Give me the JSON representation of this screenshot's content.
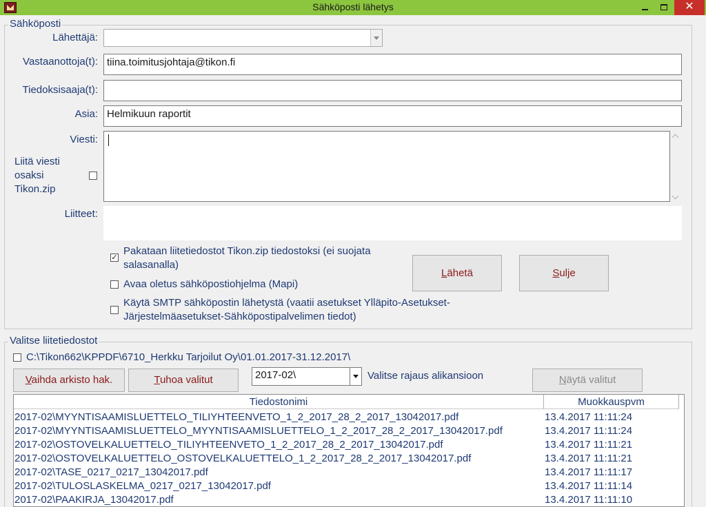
{
  "window": {
    "title": "Sähköposti lähetys"
  },
  "email": {
    "group_label": "Sähköposti",
    "sender_label": "Lähettäjä:",
    "sender_value": "",
    "recipients_label": "Vastaanottoja(t):",
    "recipients_value": "tiina.toimitusjohtaja@tikon.fi",
    "cc_label": "Tiedoksisaaja(t):",
    "cc_value": "",
    "subject_label": "Asia:",
    "subject_value": "Helmikuun raportit",
    "message_label": "Viesti:",
    "attach_message_label": "Liitä viesti osaksi Tikon.zip",
    "attach_message_checked": false,
    "attachments_label": "Liitteet:",
    "attachments_value": "",
    "options": [
      {
        "label": "Pakataan liitetiedostot Tikon.zip tiedostoksi  (ei suojata salasanalla)",
        "checked": true
      },
      {
        "label": "Avaa oletus sähköpostiohjelma (Mapi)",
        "checked": false
      },
      {
        "label": "Käytä SMTP sähköpostin lähetystä (vaatii asetukset Ylläpito-Asetukset-Järjestelmäasetukset-Sähköpostipalvelimen tiedot)",
        "checked": false
      }
    ],
    "send_button": {
      "underline": "L",
      "rest": "ähetä"
    },
    "close_button": {
      "underline": "S",
      "rest": "ulje"
    }
  },
  "files": {
    "group_label": "Valitse liitetiedostot",
    "archive_path": "C:\\Tikon662\\KPPDF\\6710_Herkku Tarjoilut Oy\\01.01.2017-31.12.2017\\",
    "archive_checked": false,
    "change_archive_button": {
      "underline": "V",
      "rest": "aihda arkisto hak."
    },
    "delete_button": {
      "underline": "T",
      "rest": "uhoa valitut"
    },
    "subfolder_value": "2017-02\\",
    "subfolder_label": "Valitse rajaus alikansioon",
    "show_selected_button": {
      "underline": "N",
      "rest": "äytä valitut"
    },
    "columns": [
      "Tiedostonimi",
      "Muokkauspvm"
    ],
    "rows": [
      {
        "name": "2017-02\\MYYNTISAAMISLUETTELO_TILIYHTEENVETO_1_2_2017_28_2_2017_13042017.pdf",
        "date": "13.4.2017 11:11:24"
      },
      {
        "name": "2017-02\\MYYNTISAAMISLUETTELO_MYYNTISAAMISLUETTELO_1_2_2017_28_2_2017_13042017.pdf",
        "date": "13.4.2017 11:11:24"
      },
      {
        "name": "2017-02\\OSTOVELKALUETTELO_TILIYHTEENVETO_1_2_2017_28_2_2017_13042017.pdf",
        "date": "13.4.2017 11:11:21"
      },
      {
        "name": "2017-02\\OSTOVELKALUETTELO_OSTOVELKALUETTELO_1_2_2017_28_2_2017_13042017.pdf",
        "date": "13.4.2017 11:11:21"
      },
      {
        "name": "2017-02\\TASE_0217_0217_13042017.pdf",
        "date": "13.4.2017 11:11:17"
      },
      {
        "name": "2017-02\\TULOSLASKELMA_0217_0217_13042017.pdf",
        "date": "13.4.2017 11:11:14"
      },
      {
        "name": "2017-02\\PAAKIRJA_13042017.pdf",
        "date": "13.4.2017 11:11:10"
      }
    ]
  }
}
